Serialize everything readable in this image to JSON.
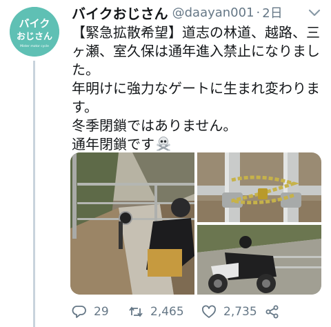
{
  "author": {
    "display_name": "バイクおじさん",
    "handle": "@daayan001",
    "separator": "·",
    "time": "2日",
    "avatar_text_line1": "バイク",
    "avatar_text_line2": "おじさん",
    "avatar_subtext": "Mister motor cycle"
  },
  "tweet": {
    "lines": [
      "【緊急拡散希望】道志の林道、越路、三",
      "ヶ瀬、室久保は通年進入禁止になりまし",
      "た。",
      "年明けに強力なゲートに生まれ変わりま",
      "す。",
      "冬季閉鎖ではありません。",
      "通年閉鎖です"
    ],
    "emoji_icon": "skull-crossbones-icon"
  },
  "media": {
    "photos": [
      "forest-gate-motorcycle-photo",
      "chained-gate-closeup-photo",
      "motorcycle-at-gate-photo"
    ]
  },
  "actions": {
    "reply_count": "29",
    "retweet_count": "2,465",
    "like_count": "2,735"
  },
  "colors": {
    "text": "#14171a",
    "secondary": "#657786",
    "avatar_bg": "#5fc0b4",
    "thread_line": "#c8d3dc"
  }
}
